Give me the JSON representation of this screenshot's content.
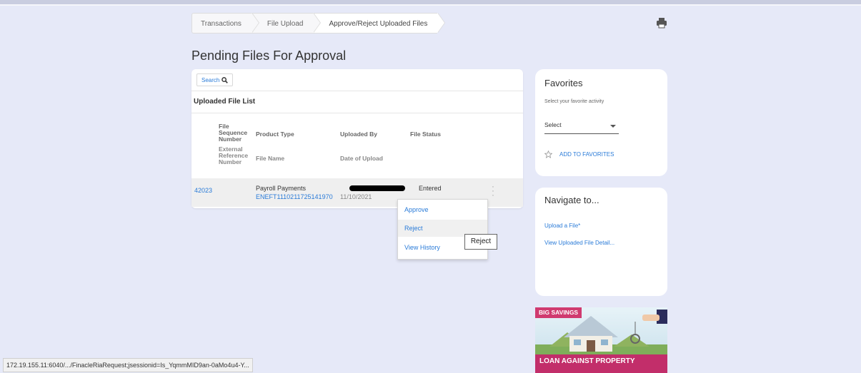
{
  "breadcrumb": [
    "Transactions",
    "File Upload",
    "Approve/Reject Uploaded Files"
  ],
  "page_title": "Pending Files For Approval",
  "search_label": "Search",
  "list_title": "Uploaded File List",
  "headers": {
    "seq": "File Sequence Number",
    "ext": "External Reference Number",
    "product": "Product Type",
    "filename": "File Name",
    "uploaded_by": "Uploaded By",
    "date": "Date of Upload",
    "status": "File Status"
  },
  "rows": [
    {
      "seq": "42023",
      "product": "Payroll Payments",
      "filename": "ENEFT1110211725141970",
      "date": "11/10/2021",
      "status": "Entered"
    }
  ],
  "context_menu": [
    "Approve",
    "Reject",
    "View History"
  ],
  "tooltip": "Reject",
  "favorites": {
    "title": "Favorites",
    "hint": "Select your favorite activity",
    "select_value": "Select",
    "add_label": "ADD TO FAVORITES"
  },
  "navigate": {
    "title": "Navigate to...",
    "links": [
      "Upload a File*",
      "View Uploaded File Detail..."
    ]
  },
  "promo": {
    "tag": "BIG SAVINGS",
    "text": "LOAN AGAINST PROPERTY"
  },
  "status_url": "172.19.155.11:6040/.../FinacleRiaRequest;jsessionid=Is_YqmmMID9an-0aMo4u4-Y...",
  "colors": {
    "background": "#e6e9f8",
    "link": "#2a7bd8",
    "promo": "#c22e6a"
  }
}
